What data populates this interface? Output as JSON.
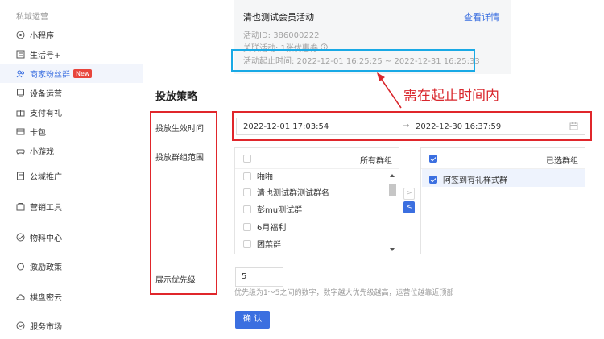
{
  "sidebar": {
    "group_label": "私域运营",
    "items": [
      {
        "label": "小程序",
        "icon": "mini-program-icon"
      },
      {
        "label": "生活号+",
        "icon": "life-account-icon"
      },
      {
        "label": "商家粉丝群",
        "icon": "fan-group-icon",
        "badge": "New"
      },
      {
        "label": "设备运营",
        "icon": "device-icon"
      },
      {
        "label": "支付有礼",
        "icon": "pay-gift-icon"
      },
      {
        "label": "卡包",
        "icon": "card-wallet-icon"
      },
      {
        "label": "小游戏",
        "icon": "game-icon"
      },
      {
        "label": "公域推广",
        "icon": "public-promo-icon"
      },
      {
        "label": "营销工具",
        "icon": "marketing-tool-icon"
      },
      {
        "label": "物料中心",
        "icon": "material-center-icon"
      },
      {
        "label": "激励政策",
        "icon": "incentive-icon"
      },
      {
        "label": "棋盘密云",
        "icon": "cloud-icon"
      },
      {
        "label": "服务市场",
        "icon": "service-market-icon"
      }
    ]
  },
  "activity": {
    "title": "清也测试会员活动",
    "link": "查看详情",
    "id_line": "活动ID: 386000222",
    "related_line": "关联活动: 1张优惠券",
    "time_line": "活动起止时间: 2022-12-01 16:25:25 ~ 2022-12-31 16:25:33"
  },
  "annotation": {
    "text": "需在起止时间内",
    "color": "#d9272d"
  },
  "strategy": {
    "title": "投放策略",
    "effective_label": "投放生效时间",
    "group_label": "投放群组范围",
    "priority_label": "展示优先级",
    "date_start": "2022-12-01 17:03:54",
    "date_sep": "→",
    "date_end": "2022-12-30 16:37:59"
  },
  "transfer": {
    "left_title": "所有群组",
    "left_items": [
      "啪啪",
      "清也测试群测试群名",
      "彭mu测试群",
      "6月福利",
      "团菜群"
    ],
    "right_title": "已选群组",
    "right_items": [
      "阿签到有礼样式群"
    ],
    "btn_right": ">",
    "btn_left": "<"
  },
  "priority": {
    "value": "5",
    "hint": "优先级为1～5之间的数字，数字越大优先级越高，运营位越靠近顶部",
    "confirm": "确 认"
  },
  "colors": {
    "accent": "#3b6fe0",
    "highlight_box": "#19a9e5",
    "annotation_box": "#e0262b"
  }
}
